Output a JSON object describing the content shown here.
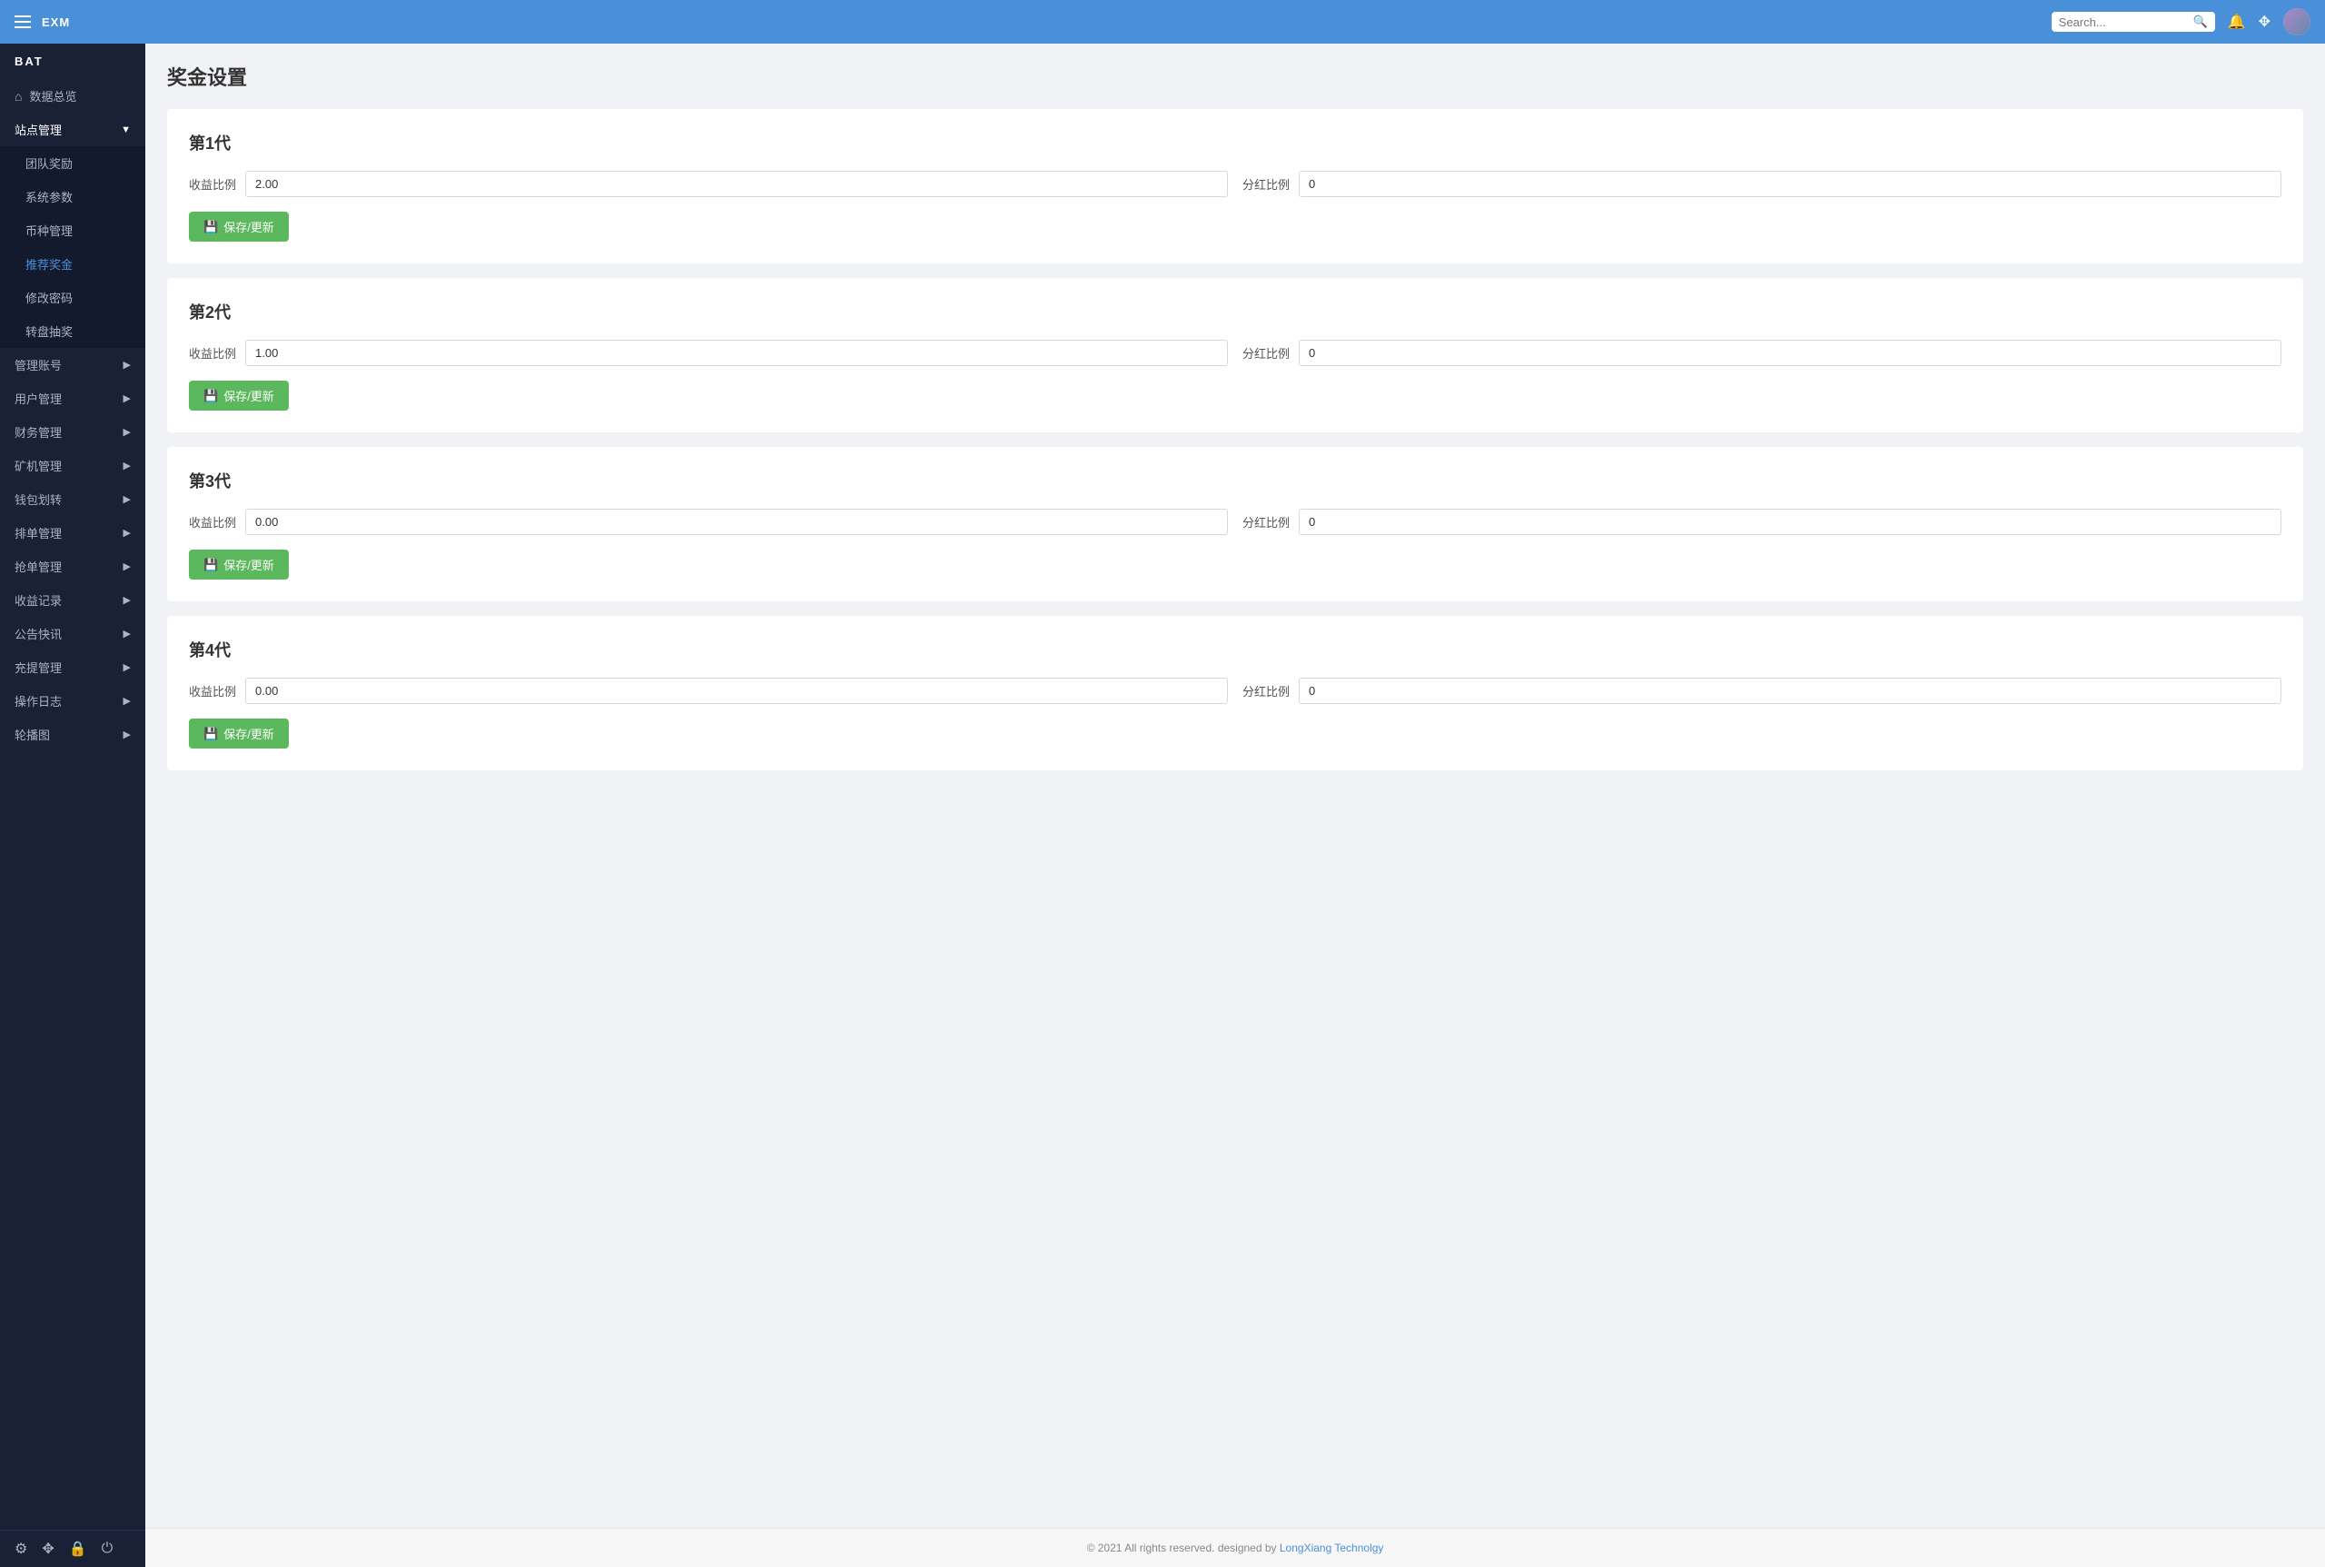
{
  "app": {
    "brand": "EXM",
    "sidebar_tag": "BAT"
  },
  "navbar": {
    "search_placeholder": "Search...",
    "hamburger_label": "Menu"
  },
  "sidebar": {
    "home_item": "数据总览",
    "group1": {
      "label": "站点管理",
      "expanded": true,
      "items": [
        {
          "label": "团队奖励",
          "active": false
        },
        {
          "label": "系统参数",
          "active": false
        },
        {
          "label": "币种管理",
          "active": false
        },
        {
          "label": "推荐奖金",
          "active": true
        },
        {
          "label": "修改密码",
          "active": false
        },
        {
          "label": "转盘抽奖",
          "active": false
        }
      ]
    },
    "group2": {
      "label": "管理账号",
      "expanded": false
    },
    "group3": {
      "label": "用户管理",
      "expanded": false
    },
    "group4": {
      "label": "财务管理",
      "expanded": false
    },
    "group5": {
      "label": "矿机管理",
      "expanded": false
    },
    "group6": {
      "label": "钱包划转",
      "expanded": false
    },
    "group7": {
      "label": "排单管理",
      "expanded": false
    },
    "group8": {
      "label": "抢单管理",
      "expanded": false
    },
    "group9": {
      "label": "收益记录",
      "expanded": false
    },
    "group10": {
      "label": "公告快讯",
      "expanded": false
    },
    "group11": {
      "label": "充提管理",
      "expanded": false
    },
    "group12": {
      "label": "操作日志",
      "expanded": false
    },
    "group13": {
      "label": "轮播图",
      "expanded": false
    }
  },
  "page": {
    "title": "奖金设置",
    "generations": [
      {
        "title": "第1代",
        "yield_label": "收益比例",
        "yield_value": "2.00",
        "dividend_label": "分红比例",
        "dividend_value": "0",
        "save_label": "保存/更新"
      },
      {
        "title": "第2代",
        "yield_label": "收益比例",
        "yield_value": "1.00",
        "dividend_label": "分红比例",
        "dividend_value": "0",
        "save_label": "保存/更新"
      },
      {
        "title": "第3代",
        "yield_label": "收益比例",
        "yield_value": "0.00",
        "dividend_label": "分红比例",
        "dividend_value": "0",
        "save_label": "保存/更新"
      },
      {
        "title": "第4代",
        "yield_label": "收益比例",
        "yield_value": "0.00",
        "dividend_label": "分红比例",
        "dividend_value": "0",
        "save_label": "保存/更新"
      }
    ]
  },
  "footer": {
    "text": "© 2021 All rights reserved. designed by ",
    "link_text": "LongXiang Technolgy",
    "link_href": "#"
  }
}
